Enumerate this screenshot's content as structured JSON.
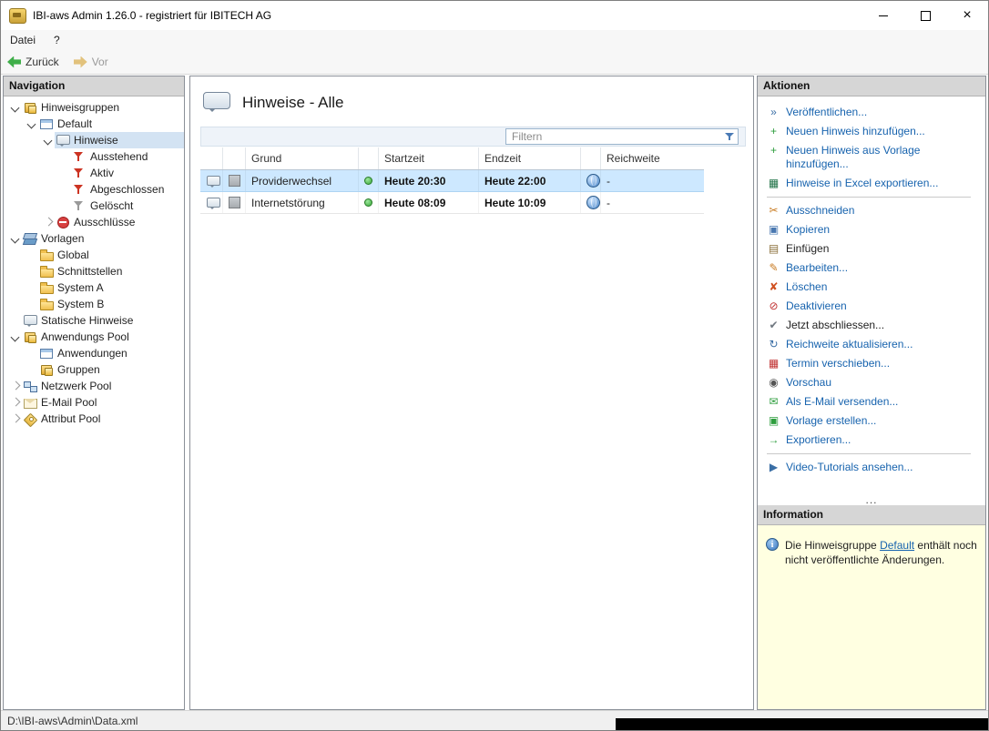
{
  "window": {
    "title": "IBI-aws Admin 1.26.0 - registriert für IBITECH AG",
    "controls": [
      "minimize",
      "maximize",
      "close"
    ]
  },
  "menu": {
    "items": [
      {
        "label": "Datei"
      },
      {
        "label": "?"
      }
    ]
  },
  "toolbar": {
    "back": "Zurück",
    "forward": "Vor"
  },
  "navigation": {
    "header": "Navigation",
    "status": "D:\\IBI-aws\\Admin\\Data.xml",
    "items": [
      {
        "label": "Hinweisgruppen",
        "level": 0,
        "chevron": "expanded",
        "icon": "group-cube",
        "selected": false
      },
      {
        "label": "Default",
        "level": 1,
        "chevron": "expanded",
        "icon": "card",
        "selected": false
      },
      {
        "label": "Hinweise",
        "level": 2,
        "chevron": "expanded",
        "icon": "bubble",
        "selected": true
      },
      {
        "label": "Ausstehend",
        "level": 3,
        "chevron": null,
        "icon": "funnel-red",
        "selected": false
      },
      {
        "label": "Aktiv",
        "level": 3,
        "chevron": null,
        "icon": "funnel-red",
        "selected": false
      },
      {
        "label": "Abgeschlossen",
        "level": 3,
        "chevron": null,
        "icon": "funnel-red",
        "selected": false
      },
      {
        "label": "Gelöscht",
        "level": 3,
        "chevron": null,
        "icon": "funnel-gray",
        "selected": false
      },
      {
        "label": "Ausschlüsse",
        "level": 2,
        "chevron": "collapsed",
        "icon": "noentry",
        "selected": false
      },
      {
        "label": "Vorlagen",
        "level": 0,
        "chevron": "expanded",
        "icon": "layers",
        "selected": false
      },
      {
        "label": "Global",
        "level": 1,
        "chevron": null,
        "icon": "folder",
        "selected": false
      },
      {
        "label": "Schnittstellen",
        "level": 1,
        "chevron": null,
        "icon": "folder",
        "selected": false
      },
      {
        "label": "System A",
        "level": 1,
        "chevron": null,
        "icon": "folder",
        "selected": false
      },
      {
        "label": "System B",
        "level": 1,
        "chevron": null,
        "icon": "folder",
        "selected": false
      },
      {
        "label": "Statische Hinweise",
        "level": 0,
        "chevron": null,
        "icon": "bubble",
        "selected": false
      },
      {
        "label": "Anwendungs Pool",
        "level": 0,
        "chevron": "expanded",
        "icon": "group-cube",
        "selected": false
      },
      {
        "label": "Anwendungen",
        "level": 1,
        "chevron": null,
        "icon": "card",
        "selected": false
      },
      {
        "label": "Gruppen",
        "level": 1,
        "chevron": null,
        "icon": "group-cube",
        "selected": false
      },
      {
        "label": "Netzwerk Pool",
        "level": 0,
        "chevron": "collapsed",
        "icon": "network",
        "selected": false
      },
      {
        "label": "E-Mail Pool",
        "level": 0,
        "chevron": "collapsed",
        "icon": "envelope",
        "selected": false
      },
      {
        "label": "Attribut Pool",
        "level": 0,
        "chevron": "collapsed",
        "icon": "tag",
        "selected": false
      }
    ]
  },
  "main": {
    "title": "Hinweise - Alle",
    "filter_placeholder": "Filtern",
    "table": {
      "columns": [
        "Grund",
        "Startzeit",
        "Endzeit",
        "Reichweite"
      ],
      "rows": [
        {
          "grund": "Providerwechsel",
          "status": "active",
          "startzeit": "Heute 20:30",
          "endzeit": "Heute 22:00",
          "reichweite": "-",
          "selected": true
        },
        {
          "grund": "Internetstörung",
          "status": "active",
          "startzeit": "Heute 08:09",
          "endzeit": "Heute 10:09",
          "reichweite": "-",
          "selected": false
        }
      ]
    }
  },
  "actions": {
    "header": "Aktionen",
    "overflow_indicator": "...",
    "items": [
      {
        "label": "Veröffentlichen...",
        "icon": "publish",
        "muted": false,
        "separator_after": false
      },
      {
        "label": "Neuen Hinweis hinzufügen...",
        "icon": "add-note",
        "muted": false,
        "separator_after": false
      },
      {
        "label": "Neuen Hinweis aus Vorlage hinzufügen...",
        "icon": "add-note-template",
        "muted": false,
        "separator_after": false
      },
      {
        "label": "Hinweise in Excel exportieren...",
        "icon": "excel",
        "muted": false,
        "separator_after": true
      },
      {
        "label": "Ausschneiden",
        "icon": "cut",
        "muted": false,
        "separator_after": false
      },
      {
        "label": "Kopieren",
        "icon": "copy",
        "muted": false,
        "separator_after": false
      },
      {
        "label": "Einfügen",
        "icon": "paste",
        "muted": true,
        "separator_after": false
      },
      {
        "label": "Bearbeiten...",
        "icon": "edit",
        "muted": false,
        "separator_after": false
      },
      {
        "label": "Löschen",
        "icon": "delete",
        "muted": false,
        "separator_after": false
      },
      {
        "label": "Deaktivieren",
        "icon": "deactivate",
        "muted": false,
        "separator_after": false
      },
      {
        "label": "Jetzt abschliessen...",
        "icon": "finish",
        "muted": true,
        "separator_after": false
      },
      {
        "label": "Reichweite aktualisieren...",
        "icon": "refresh",
        "muted": false,
        "separator_after": false
      },
      {
        "label": "Termin verschieben...",
        "icon": "reschedule",
        "muted": false,
        "separator_after": false
      },
      {
        "label": "Vorschau",
        "icon": "preview",
        "muted": false,
        "separator_after": false
      },
      {
        "label": "Als E-Mail versenden...",
        "icon": "email",
        "muted": false,
        "separator_after": false
      },
      {
        "label": "Vorlage erstellen...",
        "icon": "template-create",
        "muted": false,
        "separator_after": false
      },
      {
        "label": "Exportieren...",
        "icon": "export",
        "muted": false,
        "separator_after": true
      },
      {
        "label": "Video-Tutorials ansehen...",
        "icon": "video",
        "muted": false,
        "separator_after": false
      }
    ]
  },
  "icon_glyphs": {
    "publish": {
      "glyph": "»",
      "color": "#3a6ea5"
    },
    "add-note": {
      "glyph": "+",
      "color": "#2e9e3e"
    },
    "add-note-template": {
      "glyph": "+",
      "color": "#2e9e3e"
    },
    "excel": {
      "glyph": "▦",
      "color": "#1f7246"
    },
    "cut": {
      "glyph": "✂",
      "color": "#c87a20"
    },
    "copy": {
      "glyph": "▣",
      "color": "#4a78b0"
    },
    "paste": {
      "glyph": "▤",
      "color": "#8a6f3a"
    },
    "edit": {
      "glyph": "✎",
      "color": "#c87a20"
    },
    "delete": {
      "glyph": "✘",
      "color": "#d05020"
    },
    "deactivate": {
      "glyph": "⊘",
      "color": "#c03030"
    },
    "finish": {
      "glyph": "✔",
      "color": "#707880"
    },
    "refresh": {
      "glyph": "↻",
      "color": "#3a6ea5"
    },
    "reschedule": {
      "glyph": "▦",
      "color": "#c03030"
    },
    "preview": {
      "glyph": "◉",
      "color": "#555555"
    },
    "email": {
      "glyph": "✉",
      "color": "#2e9e3e"
    },
    "template-create": {
      "glyph": "▣",
      "color": "#2e9e3e"
    },
    "export": {
      "glyph": "→",
      "color": "#2e9e3e"
    },
    "video": {
      "glyph": "▶",
      "color": "#3a6ea5"
    }
  },
  "colors": {
    "action_link": "#1763ae",
    "action_muted": "#222222",
    "selected_row": "#cde8ff",
    "tree_selection": "#d3e3f3",
    "info_background": "#ffffe1",
    "status_dot": "#3aa83a"
  },
  "information": {
    "header": "Information",
    "text_before": "Die Hinweisgruppe ",
    "link": "Default",
    "text_after": " enthält noch nicht veröffentlichte Änderungen."
  }
}
